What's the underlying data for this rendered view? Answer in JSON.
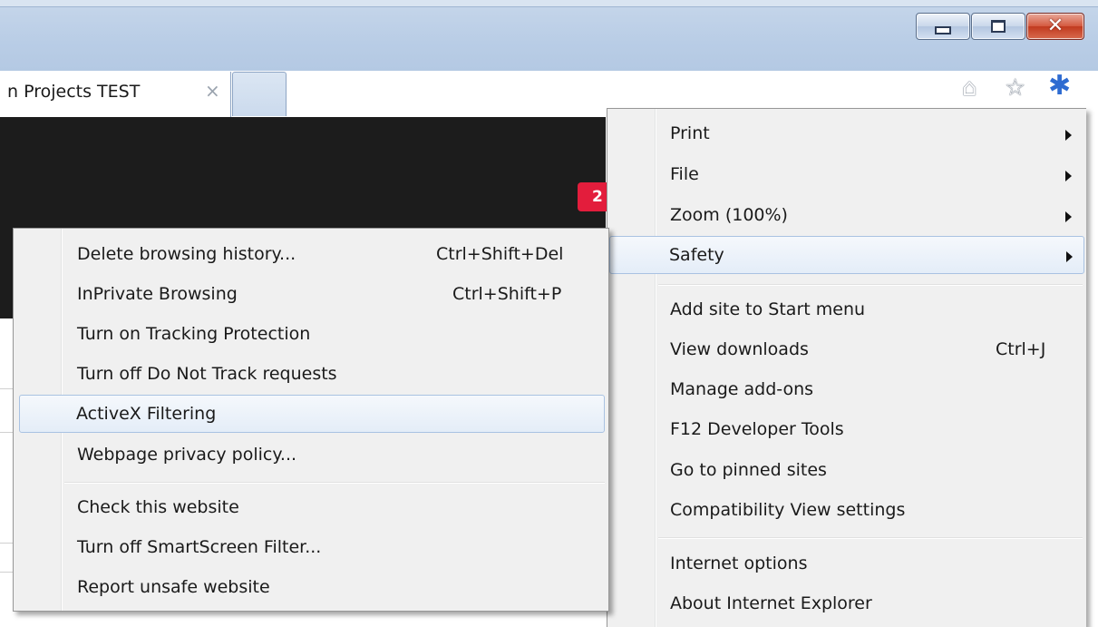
{
  "browser": {
    "tab": {
      "title": "n Projects TEST",
      "close_glyph": "×"
    },
    "window_controls": {
      "minimize": "minimize-icon",
      "maximize": "maximize-icon",
      "close_glyph": "✕"
    },
    "toolbar_icons": [
      "home-icon",
      "star-icon",
      "gear-icon"
    ],
    "notification_badge": "2"
  },
  "tools_menu": {
    "items": [
      {
        "label": "Print",
        "shortcut": "",
        "submenu": true
      },
      {
        "label": "File",
        "shortcut": "",
        "submenu": true
      },
      {
        "label": "Zoom (100%)",
        "shortcut": "",
        "submenu": true
      },
      {
        "label": "Safety",
        "shortcut": "",
        "submenu": true,
        "highlighted": true
      },
      {
        "label": "Add site to Start menu",
        "shortcut": ""
      },
      {
        "label": "View downloads",
        "shortcut": "Ctrl+J"
      },
      {
        "label": "Manage add-ons",
        "shortcut": ""
      },
      {
        "label": "F12 Developer Tools",
        "shortcut": ""
      },
      {
        "label": "Go to pinned sites",
        "shortcut": ""
      },
      {
        "label": "Compatibility View settings",
        "shortcut": ""
      },
      {
        "label": "Internet options",
        "shortcut": ""
      },
      {
        "label": "About Internet Explorer",
        "shortcut": ""
      }
    ]
  },
  "safety_menu": {
    "items": [
      {
        "label": "Delete browsing history...",
        "shortcut": "Ctrl+Shift+Del"
      },
      {
        "label": "InPrivate Browsing",
        "shortcut": "Ctrl+Shift+P"
      },
      {
        "label": "Turn on Tracking Protection",
        "shortcut": ""
      },
      {
        "label": "Turn off Do Not Track requests",
        "shortcut": ""
      },
      {
        "label": "ActiveX Filtering",
        "shortcut": "",
        "highlighted": true
      },
      {
        "label": "Webpage privacy policy...",
        "shortcut": ""
      },
      {
        "label": "Check this website",
        "shortcut": ""
      },
      {
        "label": "Turn off SmartScreen Filter...",
        "shortcut": ""
      },
      {
        "label": "Report unsafe website",
        "shortcut": ""
      }
    ]
  },
  "colors": {
    "frame": "#b9cde6",
    "menu_bg": "#f0f0f0",
    "highlight_border": "#a9c2e2",
    "badge": "#e31d3c",
    "gear": "#2e6bd1"
  }
}
